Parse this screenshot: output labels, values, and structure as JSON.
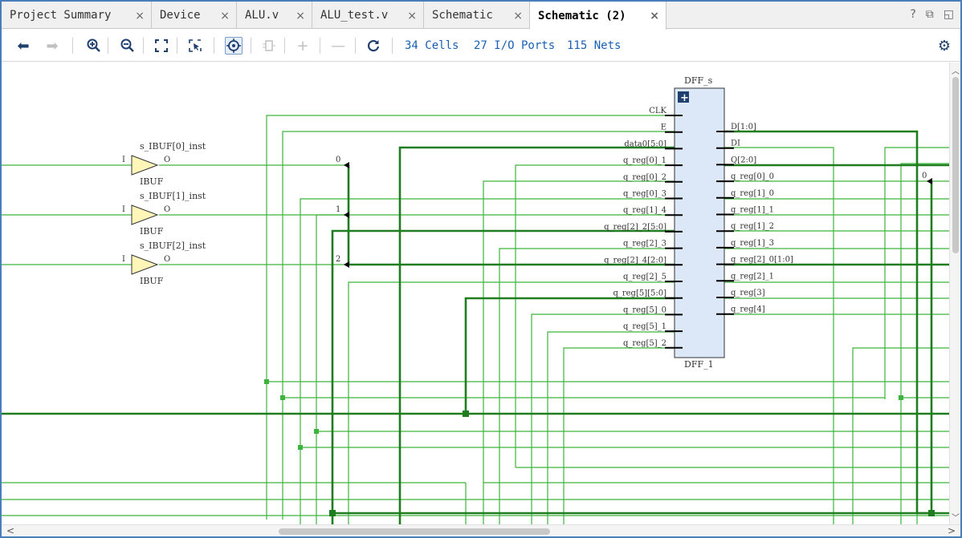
{
  "tabs": [
    {
      "label": "Project Summary",
      "active": false
    },
    {
      "label": "Device",
      "active": false
    },
    {
      "label": "ALU.v",
      "active": false
    },
    {
      "label": "ALU_test.v",
      "active": false
    },
    {
      "label": "Schematic",
      "active": false
    },
    {
      "label": "Schematic (2)",
      "active": true
    }
  ],
  "window_icons": {
    "help": "?",
    "restore": "⧉",
    "float": "◱"
  },
  "toolbar": {
    "cells": "34 Cells",
    "io_ports": "27 I/O Ports",
    "nets": "115 Nets"
  },
  "schematic": {
    "ibufs": [
      {
        "name": "s_IBUF[0]_inst",
        "type": "IBUF",
        "in_pin": "I",
        "out_pin": "O"
      },
      {
        "name": "s_IBUF[1]_inst",
        "type": "IBUF",
        "in_pin": "I",
        "out_pin": "O"
      },
      {
        "name": "s_IBUF[2]_inst",
        "type": "IBUF",
        "in_pin": "I",
        "out_pin": "O"
      }
    ],
    "bus_taps": [
      "0",
      "1",
      "2"
    ],
    "right_tap": "0",
    "cell": {
      "top_label": "DFF_s",
      "bottom_label": "DFF_1",
      "expand": "+",
      "left_pins": [
        "CLK",
        "E",
        "data0[5:0]",
        "q_reg[0]_1",
        "q_reg[0]_2",
        "q_reg[0]_3",
        "q_reg[1]_4",
        "q_reg[2]_2[5:0]",
        "q_reg[2]_3",
        "q_reg[2]_4[2:0]",
        "q_reg[2]_5",
        "q_reg[5][5:0]",
        "q_reg[5]_0",
        "q_reg[5]_1",
        "q_reg[5]_2"
      ],
      "right_pins": [
        "D[1:0]",
        "DI",
        "Q[2:0]",
        "q_reg[0]_0",
        "q_reg[1]_0",
        "q_reg[1]_1",
        "q_reg[1]_2",
        "q_reg[1]_3",
        "q_reg[2]_0[1:0]",
        "q_reg[2]_1",
        "q_reg[3]",
        "q_reg[4]"
      ]
    },
    "colors": {
      "wire": "#3cb43c",
      "bus": "#1e7d1e",
      "cell_fill": "#dce8f7",
      "buffer_fill": "#fff6b8"
    }
  }
}
